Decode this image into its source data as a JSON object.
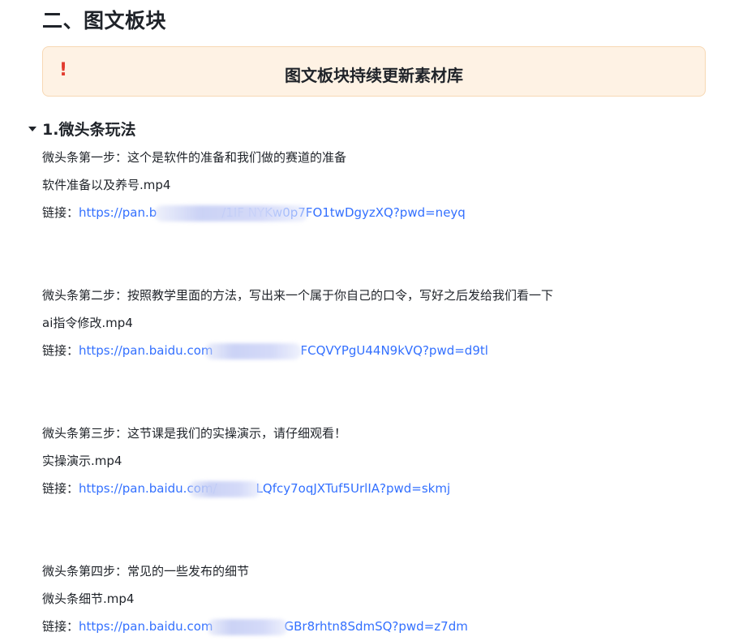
{
  "section_heading": "二、图文板块",
  "callout": {
    "icon": "exclamation-icon",
    "icon_color": "#e23b2e",
    "text": "图文板块持续更新素材库",
    "background": "#fef2e4",
    "border": "#f7d8b4"
  },
  "subsection": {
    "heading": "1.微头条玩法",
    "collapsed": false
  },
  "link_color": "#3370ff",
  "steps": [
    {
      "description": "微头条第一步：这个是软件的准备和我们做的赛道的准备",
      "file": "软件准备以及养号.mp4",
      "link_label": "链接：",
      "url": "https://pan.b",
      "url_tail": "/1IF  NYKw0p7FO1twDgyzXQ?pwd=neyq"
    },
    {
      "description": "微头条第二步：按照教学里面的方法，写出来一个属于你自己的口令，写好之后发给我们看一下",
      "file": "ai指令修改.mp4",
      "link_label": "链接：",
      "url": "https://pan.baidu.com",
      "url_tail": "FCQVYPgU44N9kVQ?pwd=d9tl"
    },
    {
      "description": "微头条第三步：这节课是我们的实操演示，请仔细观看！",
      "file": "实操演示.mp4",
      "link_label": "链接：",
      "url": "https://pan.baidu.com/",
      "url_tail": "LQfcy7oqJXTuf5UrlIA?pwd=skmj"
    },
    {
      "description": "微头条第四步：常见的一些发布的细节",
      "file": "微头条细节.mp4",
      "link_label": "链接：",
      "url": "https://pan.baidu.com",
      "url_tail": "GBr8rhtn8SdmSQ?pwd=z7dm"
    }
  ]
}
